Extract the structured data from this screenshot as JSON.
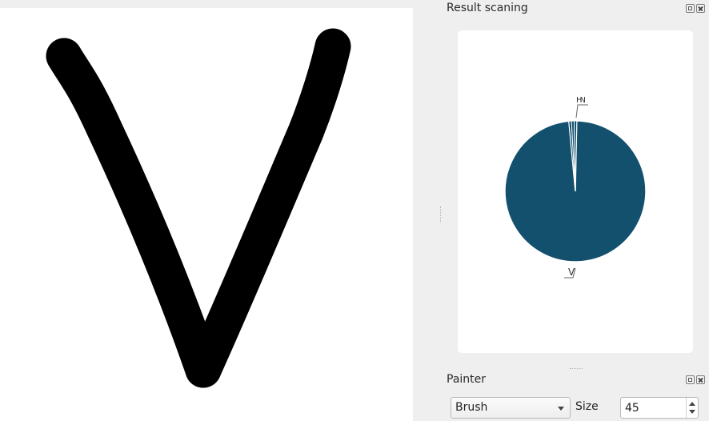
{
  "drawing_canvas": {
    "background": "#ffffff",
    "stroke_color": "#000000"
  },
  "result_dock": {
    "title": "Result scaning"
  },
  "painter_dock": {
    "title": "Painter",
    "tool": {
      "selected": "Brush"
    },
    "size": {
      "label": "Size",
      "value": "45"
    }
  },
  "chart_data": {
    "type": "pie",
    "slice_color": "#12506e",
    "slices": [
      {
        "label": "V",
        "value": 98.2
      },
      {
        "label": "",
        "value": 0.6
      },
      {
        "label": "",
        "value": 0.6
      },
      {
        "label": "",
        "value": 0.6
      }
    ],
    "top_label_glyphs": "IHN"
  }
}
